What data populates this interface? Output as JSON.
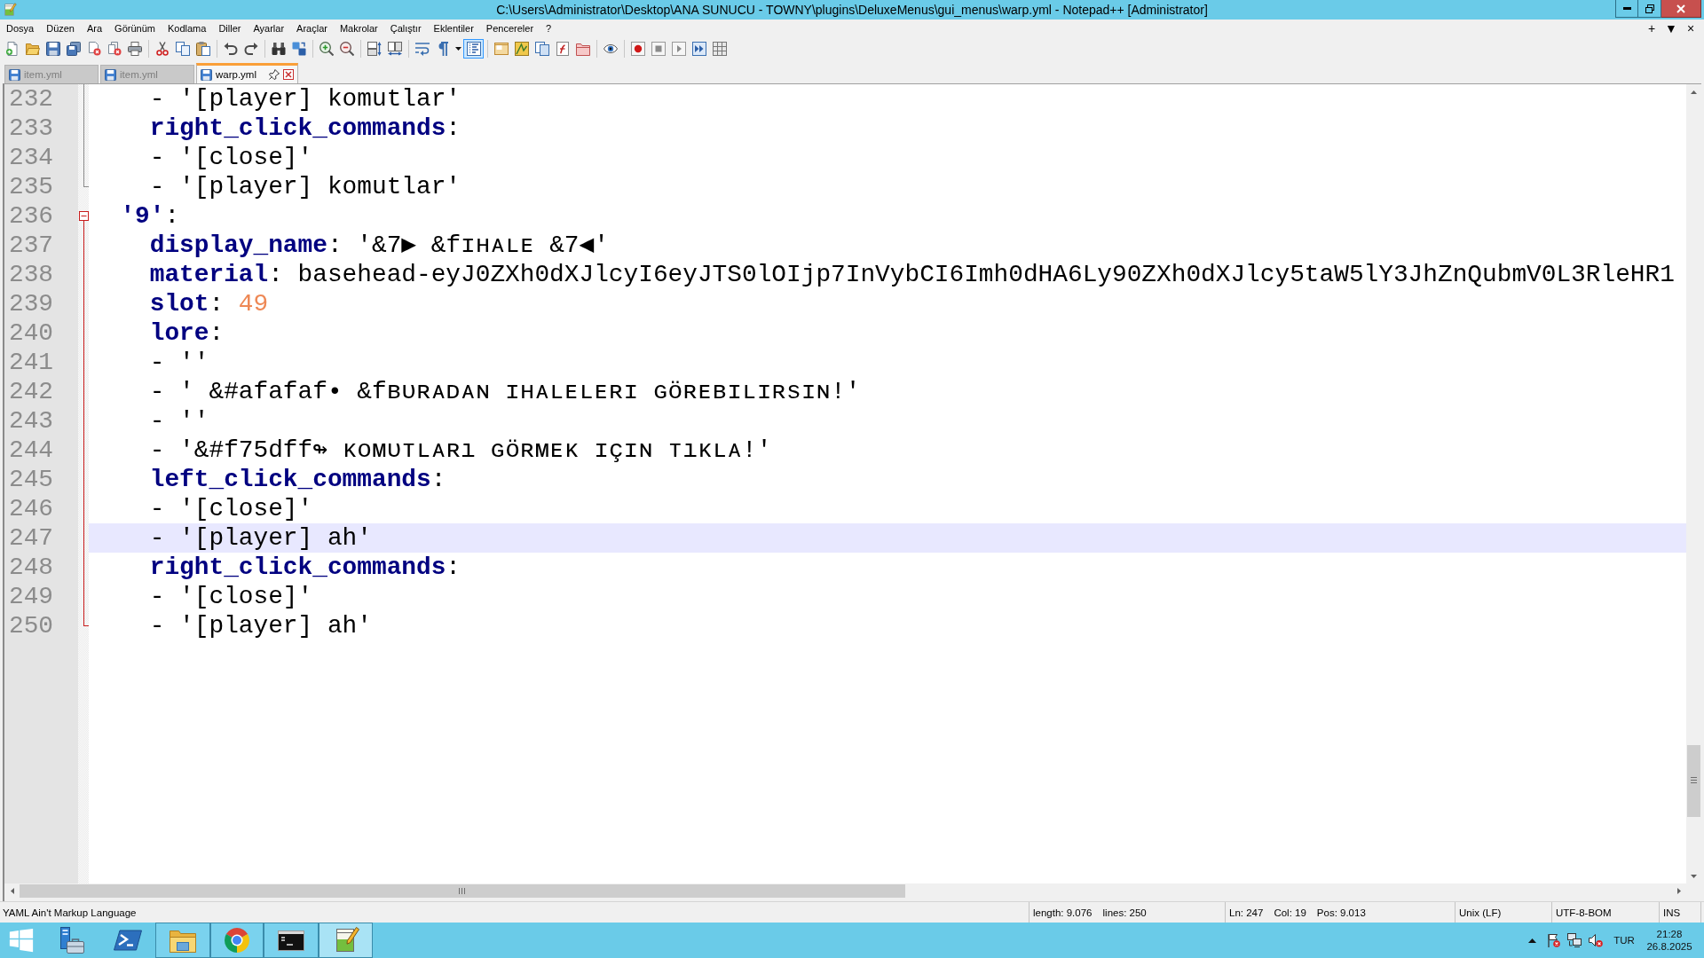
{
  "window": {
    "title": "C:\\Users\\Administrator\\Desktop\\ANA SUNUCU - TOWNY\\plugins\\DeluxeMenus\\gui_menus\\warp.yml - Notepad++ [Administrator]"
  },
  "menu": [
    "Dosya",
    "Düzen",
    "Ara",
    "Görünüm",
    "Kodlama",
    "Diller",
    "Ayarlar",
    "Araçlar",
    "Makrolar",
    "Çalıştır",
    "Eklentiler",
    "Pencereler",
    "?"
  ],
  "tab_bar_buttons": [
    "+",
    "▼",
    "×"
  ],
  "toolbar": [
    [
      {
        "kind": "new",
        "pressed": false
      },
      {
        "kind": "open",
        "pressed": false
      },
      {
        "kind": "save",
        "pressed": false
      },
      {
        "kind": "saveall",
        "pressed": false
      },
      {
        "kind": "close",
        "pressed": false
      },
      {
        "kind": "closeall",
        "pressed": false
      },
      {
        "kind": "print",
        "pressed": false
      }
    ],
    [
      {
        "kind": "cut",
        "pressed": false
      },
      {
        "kind": "copy",
        "pressed": false
      },
      {
        "kind": "paste",
        "pressed": false
      }
    ],
    [
      {
        "kind": "undo",
        "pressed": false
      },
      {
        "kind": "redo",
        "pressed": false
      }
    ],
    [
      {
        "kind": "find",
        "pressed": false
      },
      {
        "kind": "replace",
        "pressed": false
      }
    ],
    [
      {
        "kind": "zoomin",
        "pressed": false
      },
      {
        "kind": "zoomout",
        "pressed": false
      }
    ],
    [
      {
        "kind": "syncv",
        "pressed": false
      },
      {
        "kind": "synch",
        "pressed": false
      }
    ],
    [
      {
        "kind": "wrap",
        "pressed": false
      },
      {
        "kind": "allchars",
        "pressed": false
      },
      {
        "kind": "dropdown",
        "pressed": false
      },
      {
        "kind": "indentguide",
        "pressed": true
      }
    ],
    [
      {
        "kind": "langpanel",
        "pressed": false
      },
      {
        "kind": "docmap",
        "pressed": false
      },
      {
        "kind": "doclist",
        "pressed": false
      },
      {
        "kind": "funclist",
        "pressed": false
      },
      {
        "kind": "workspace",
        "pressed": false
      }
    ],
    [
      {
        "kind": "monitor",
        "pressed": false
      }
    ],
    [
      {
        "kind": "record",
        "pressed": false
      },
      {
        "kind": "stop",
        "pressed": false
      },
      {
        "kind": "play",
        "pressed": false
      },
      {
        "kind": "playmulti",
        "pressed": false
      },
      {
        "kind": "savemacro",
        "pressed": false
      }
    ]
  ],
  "tabs": [
    {
      "label": "item.yml",
      "selected": false,
      "modified": false
    },
    {
      "label": "item.yml",
      "selected": false,
      "modified": false
    },
    {
      "label": "warp.yml",
      "selected": true,
      "modified": false
    }
  ],
  "editor": {
    "lines": [
      {
        "number": "232",
        "tokens": [
          {
            "kind": "plain",
            "text": "    - '[player] komutlar'"
          }
        ],
        "current": false
      },
      {
        "number": "233",
        "tokens": [
          {
            "kind": "key",
            "text": "    right_click_commands"
          },
          {
            "kind": "plain",
            "text": ":"
          }
        ],
        "current": false
      },
      {
        "number": "234",
        "tokens": [
          {
            "kind": "plain",
            "text": "    - '[close]'"
          }
        ],
        "current": false
      },
      {
        "number": "235",
        "tokens": [
          {
            "kind": "plain",
            "text": "    - '[player] komutlar'"
          }
        ],
        "current": false
      },
      {
        "number": "236",
        "tokens": [
          {
            "kind": "key",
            "text": "  '9'"
          },
          {
            "kind": "plain",
            "text": ":"
          }
        ],
        "current": false,
        "expanded": true,
        "children": [
          {
            "number": "237",
            "tokens": [
              {
                "kind": "key",
                "text": "    display_name"
              },
              {
                "kind": "plain",
                "text": ": '&7▶ &fɪʜᴀʟᴇ &7◀'"
              }
            ],
            "current": false
          },
          {
            "number": "238",
            "tokens": [
              {
                "kind": "key",
                "text": "    material"
              },
              {
                "kind": "plain",
                "text": ": basehead-eyJ0ZXh0dXJlcyI6eyJTS0lOIjp7InVybCI6Imh0dHA6Ly90ZXh0dXJlcy5taW5lY3JhZnQubmV0L3RleHR1"
              }
            ],
            "current": false
          },
          {
            "number": "239",
            "tokens": [
              {
                "kind": "key",
                "text": "    slot"
              },
              {
                "kind": "plain",
                "text": ": "
              },
              {
                "kind": "number",
                "text": "49"
              }
            ],
            "current": false
          },
          {
            "number": "240",
            "tokens": [
              {
                "kind": "key",
                "text": "    lore"
              },
              {
                "kind": "plain",
                "text": ":"
              }
            ],
            "current": false
          },
          {
            "number": "241",
            "tokens": [
              {
                "kind": "plain",
                "text": "    - ''"
              }
            ],
            "current": false
          },
          {
            "number": "242",
            "tokens": [
              {
                "kind": "plain",
                "text": "    - ' &#afafaf• &fʙᴜʀᴀᴅᴀɴ ɪʜᴀʟᴇʟᴇʀɪ ɢöʀᴇʙɪʟɪʀsɪɴ!'"
              }
            ],
            "current": false
          },
          {
            "number": "243",
            "tokens": [
              {
                "kind": "plain",
                "text": "    - ''"
              }
            ],
            "current": false
          },
          {
            "number": "244",
            "tokens": [
              {
                "kind": "plain",
                "text": "    - '&#f75dff↬ ᴋᴏᴍᴜᴛʟᴀʀı ɢöʀᴍᴇᴋ ɪçɪɴ ᴛıᴋʟᴀ!'"
              }
            ],
            "current": false
          },
          {
            "number": "245",
            "tokens": [
              {
                "kind": "key",
                "text": "    left_click_commands"
              },
              {
                "kind": "plain",
                "text": ":"
              }
            ],
            "current": false
          },
          {
            "number": "246",
            "tokens": [
              {
                "kind": "plain",
                "text": "    - '[close]'"
              }
            ],
            "current": false
          },
          {
            "number": "247",
            "tokens": [
              {
                "kind": "plain",
                "text": "    - '[player] ah'"
              }
            ],
            "current": true
          },
          {
            "number": "248",
            "tokens": [
              {
                "kind": "key",
                "text": "    right_click_commands"
              },
              {
                "kind": "plain",
                "text": ":"
              }
            ],
            "current": false
          },
          {
            "number": "249",
            "tokens": [
              {
                "kind": "plain",
                "text": "    - '[close]'"
              }
            ],
            "current": false
          },
          {
            "number": "250",
            "tokens": [
              {
                "kind": "plain",
                "text": "    - '[player] ah'"
              }
            ],
            "current": false
          }
        ]
      }
    ]
  },
  "status_bar": {
    "language": "YAML Ain't Markup Language",
    "length": "length: 9.076",
    "lines": "lines: 250",
    "line": "Ln: 247",
    "column": "Col: 19",
    "position": "Pos: 9.013",
    "eol": "Unix (LF)",
    "encoding": "UTF-8-BOM",
    "mode": "INS"
  },
  "taskbar": {
    "apps": [
      {
        "kind": "start",
        "running": false,
        "selected": false
      },
      {
        "kind": "servermanager",
        "running": false,
        "selected": false
      },
      {
        "kind": "powershell",
        "running": false,
        "selected": false
      },
      {
        "kind": "explorer",
        "running": true,
        "selected": false
      },
      {
        "kind": "browser",
        "running": true,
        "selected": false
      },
      {
        "kind": "terminal",
        "running": true,
        "selected": false
      },
      {
        "kind": "notepad",
        "running": true,
        "selected": true
      }
    ],
    "language": "TUR",
    "time": "21:28",
    "date": "26.8.2025"
  }
}
